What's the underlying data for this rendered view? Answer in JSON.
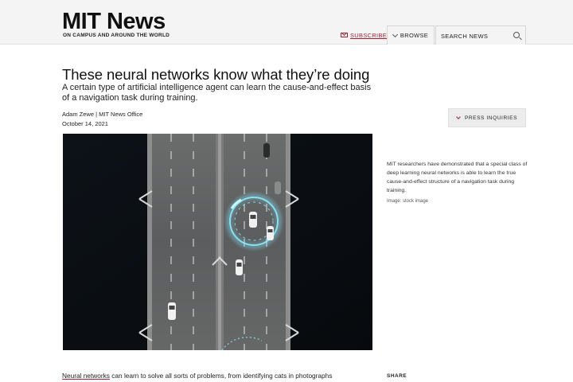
{
  "header": {
    "logo_title": "MIT News",
    "logo_tagline": "ON CAMPUS AND AROUND THE WORLD",
    "subscribe_label": "SUBSCRIBE",
    "browse_label": "BROWSE",
    "search_placeholder": "SEARCH NEWS",
    "accent_color": "#a31f34"
  },
  "article": {
    "headline": "These neural networks know what they’re doing",
    "dek": "A certain type of artificial intelligence agent can learn the cause-and-effect basis of a navigation task during training.",
    "author": "Adam Zewe",
    "office": "MIT News Office",
    "date": "October 14, 2021",
    "press_label": "PRESS INQUIRIES",
    "image_caption": "MIT researchers have demonstrated that a special class of deep learning neural networks is able to learn the true cause-and-effect structure of a navigation task during training.",
    "image_credit": "Image: stock image",
    "body_link": "Neural networks",
    "body_rest": " can learn to solve all sorts of problems, from identifying cats in photographs",
    "share_label": "SHARE"
  }
}
